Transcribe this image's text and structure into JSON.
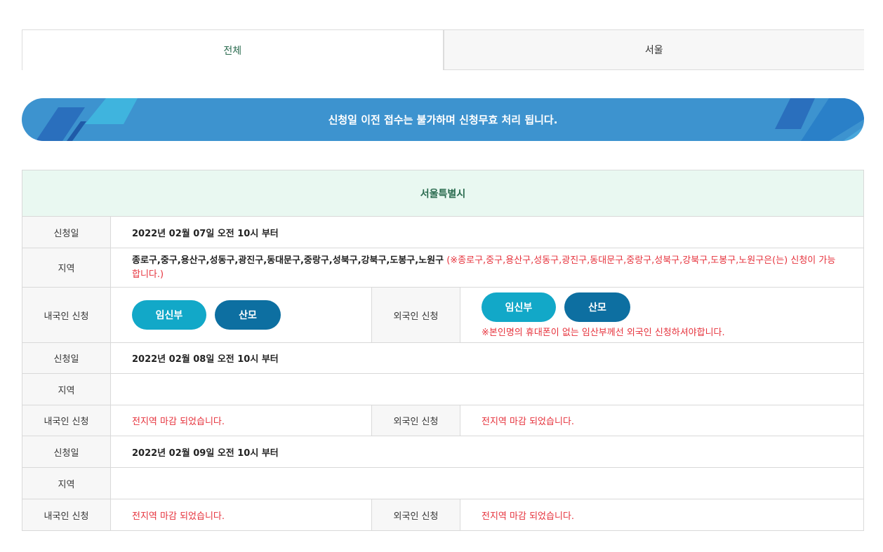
{
  "tabs": {
    "all": "전체",
    "seoul": "서울"
  },
  "banner": {
    "text": "신청일 이전 접수는 불가하며 신청무효 처리 됩니다."
  },
  "table": {
    "title": "서울특별시",
    "labels": {
      "date": "신청일",
      "region": "지역",
      "domestic": "내국인 신청",
      "foreign": "외국인 신청"
    },
    "blocks": [
      {
        "date": "2022년 02월 07일 오전 10시 부터",
        "region": "종로구,중구,용산구,성동구,광진구,동대문구,중랑구,성북구,강북구,도봉구,노원구",
        "region_note": " (※종로구,중구,용산구,성동구,광진구,동대문구,중랑구,성북구,강북구,도봉구,노원구은(는) 신청이 가능합니다.)",
        "domestic_buttons": {
          "pregnant": "임신부",
          "mother": "산모"
        },
        "foreign_buttons": {
          "pregnant": "임신부",
          "mother": "산모"
        },
        "foreign_note": "※본인명의 휴대폰이 없는 임산부께선 외국인 신청하셔야합니다."
      },
      {
        "date": "2022년 02월 08일 오전 10시 부터",
        "region": "",
        "domestic_status": "전지역 마감 되었습니다.",
        "foreign_status": "전지역 마감 되었습니다."
      },
      {
        "date": "2022년 02월 09일 오전 10시 부터",
        "region": "",
        "domestic_status": "전지역 마감 되었습니다.",
        "foreign_status": "전지역 마감 되었습니다."
      }
    ]
  },
  "colors": {
    "accent_green": "#2a6b4f",
    "banner_blue": "#3d93cf",
    "button_cyan": "#12a8c8",
    "button_blue": "#0d6fa1",
    "alert_red": "#e6323c"
  }
}
